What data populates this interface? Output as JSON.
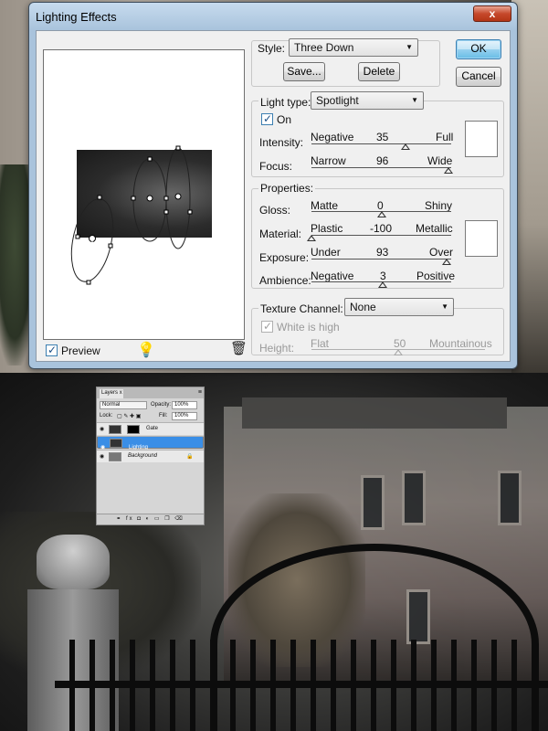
{
  "dialog": {
    "title": "Lighting Effects",
    "close_glyph": "x",
    "preview_label": "Preview",
    "preview_checked": true,
    "bulb_icon": "lightbulb-icon",
    "trash_icon": "trash-icon"
  },
  "style": {
    "label": "Style:",
    "value": "Three Down",
    "save_label": "Save...",
    "delete_label": "Delete"
  },
  "buttons": {
    "ok": "OK",
    "cancel": "Cancel"
  },
  "light_type": {
    "label": "Light type:",
    "value": "Spotlight",
    "on_label": "On",
    "on_checked": true,
    "intensity": {
      "label": "Intensity:",
      "min": "Negative",
      "max": "Full",
      "value": "35",
      "fraction": 0.67
    },
    "focus": {
      "label": "Focus:",
      "min": "Narrow",
      "max": "Wide",
      "value": "96",
      "fraction": 0.98
    }
  },
  "properties": {
    "label": "Properties:",
    "gloss": {
      "label": "Gloss:",
      "min": "Matte",
      "max": "Shiny",
      "value": "0",
      "fraction": 0.5
    },
    "material": {
      "label": "Material:",
      "min": "Plastic",
      "max": "Metallic",
      "value": "-100",
      "fraction": 0.0
    },
    "exposure": {
      "label": "Exposure:",
      "min": "Under",
      "max": "Over",
      "value": "93",
      "fraction": 0.97
    },
    "ambience": {
      "label": "Ambience:",
      "min": "Negative",
      "max": "Positive",
      "value": "3",
      "fraction": 0.51
    }
  },
  "texture": {
    "label": "Texture Channel:",
    "value": "None",
    "white_high_label": "White is high",
    "white_high_checked": true,
    "height": {
      "label": "Height:",
      "min": "Flat",
      "max": "Mountainous",
      "value": "50",
      "fraction": 0.5
    }
  },
  "layers_panel": {
    "tab": "Layers",
    "close_glyph": "x",
    "blend_mode": "Normal",
    "opacity_label": "Opacity:",
    "opacity_value": "100%",
    "lock_label": "Lock:",
    "fill_label": "Fill:",
    "fill_value": "100%",
    "layers": [
      {
        "name": "Gate",
        "selected": false
      },
      {
        "name": "Lighting",
        "selected": true
      },
      {
        "name": "Background",
        "selected": false
      }
    ],
    "footer_icons": "link fx mask adj folder new trash"
  }
}
